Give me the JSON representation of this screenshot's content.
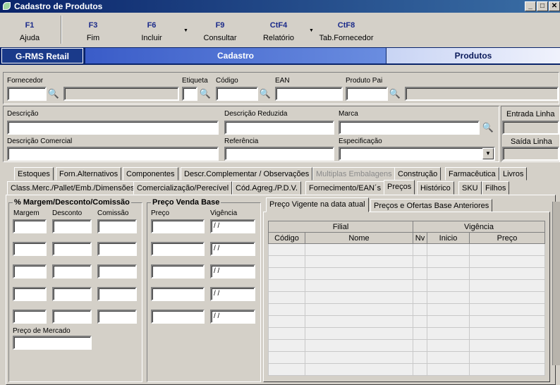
{
  "window": {
    "title": "Cadastro de Produtos",
    "min": "_",
    "max": "□",
    "close": "✕"
  },
  "toolbar": [
    {
      "key": "F1",
      "label": "Ajuda"
    },
    {
      "key": "F3",
      "label": "Fim"
    },
    {
      "key": "F6",
      "label": "Incluir"
    },
    {
      "key": "F9",
      "label": "Consultar"
    },
    {
      "key": "CtF4",
      "label": "Relatório"
    },
    {
      "key": "CtF8",
      "label": "Tab.Fornecedor"
    }
  ],
  "banner": {
    "brand": "G-RMS Retail",
    "section": "Cadastro",
    "module": "Produtos"
  },
  "form": {
    "fornecedor": "Fornecedor",
    "etiqueta": "Etiqueta",
    "codigo": "Código",
    "ean": "EAN",
    "produto_pai": "Produto Pai",
    "descricao": "Descrição",
    "descricao_reduzida": "Descrição Reduzida",
    "marca": "Marca",
    "descricao_comercial": "Descrição Comercial",
    "referencia": "Referência",
    "especificacao": "Especificação",
    "entrada_linha": "Entrada Linha",
    "saida_linha": "Saída Linha"
  },
  "tabs_row1": [
    "Estoques",
    "Forn.Alternativos",
    "Componentes",
    "Descr.Complementar / Observações",
    "Multiplas Embalagens",
    "Construção",
    "Farmacêutica",
    "Livros"
  ],
  "tabs_row2": [
    "Class.Merc./Pallet/Emb./Dimensões",
    "Comercialização/Perecível",
    "Cód.Agreg./P.D.V.",
    "Fornecimento/EAN´s",
    "Preços",
    "Histórico",
    "SKU",
    "Filhos"
  ],
  "margem_group": {
    "title": "% Margem/Desconto/Comissão",
    "col_margem": "Margem",
    "col_desconto": "Desconto",
    "col_comissao": "Comissão",
    "preco_mercado": "Preço de Mercado"
  },
  "preco_group": {
    "title": "Preço Venda Base",
    "col_preco": "Preço",
    "col_vigencia": "Vigência",
    "date_mask": " / /"
  },
  "subtabs": [
    "Preço Vigente na data atual",
    "Preços e Ofertas Base Anteriores"
  ],
  "grid": {
    "group_filial": "Filial",
    "group_vigencia": "Vigência",
    "cols": [
      "Código",
      "Nome",
      "Nv",
      "Inicio",
      "Preço"
    ]
  }
}
